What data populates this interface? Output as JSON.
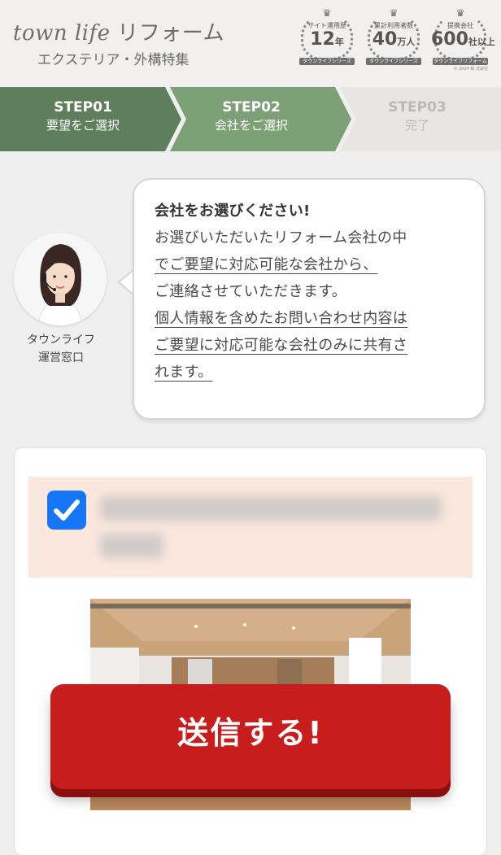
{
  "header": {
    "brand": "town life",
    "service": "リフォーム",
    "subtitle": "エクステリア・外構特集",
    "copyright": "© 2024 株 式会社"
  },
  "badges": [
    {
      "label": "サイト運用歴",
      "number": "12",
      "unit": "年",
      "ribbon": "タウンライフシリーズ"
    },
    {
      "label": "累計利用者数",
      "number": "40",
      "unit": "万人",
      "ribbon": "タウンライフシリーズ"
    },
    {
      "label": "提携会社",
      "number": "600",
      "unit": "社以上",
      "ribbon": "タウンライフリフォーム"
    }
  ],
  "steps": [
    {
      "id": "STEP01",
      "label": "要望をご選択",
      "state": "done"
    },
    {
      "id": "STEP02",
      "label": "会社をご選択",
      "state": "current"
    },
    {
      "id": "STEP03",
      "label": "完了",
      "state": "upcoming"
    }
  ],
  "colors": {
    "step_done": "#5f7e5c",
    "step_current": "#7ea077",
    "step_upcoming": "#e8e6e4",
    "submit": "#c71d1d",
    "checkbox": "#1677f6",
    "company_bg": "#fbe7dd"
  },
  "operator": {
    "line1": "タウンライフ",
    "line2": "運営窓口"
  },
  "message": {
    "title": "会社をお選びください!",
    "line1": "お選びいただいたリフォーム会社の中",
    "line2a": "で",
    "line2b": "ご要望に対応可能な会社から、",
    "line3": "ご連絡させていただきます。",
    "line4": "個人情報を含めたお問い合わせ内容は",
    "line5": "ご要望に対応可能な会社のみに共有さ",
    "line6": "れます。"
  },
  "company": {
    "checked": true,
    "check_icon": "checkmark-icon"
  },
  "submit": {
    "label": "送信する!"
  }
}
